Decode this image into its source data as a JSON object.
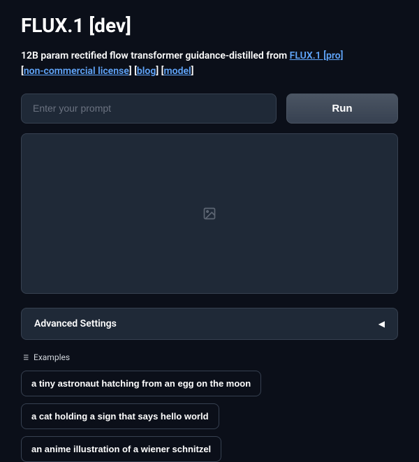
{
  "title": "FLUX.1 [dev]",
  "description": {
    "prefix": "12B param rectified flow transformer guidance-distilled from ",
    "link1": "FLUX.1 [pro]",
    "link2": "non-commercial license",
    "link3": "blog",
    "link4": "model"
  },
  "prompt": {
    "placeholder": "Enter your prompt",
    "value": ""
  },
  "run_button": "Run",
  "advanced_settings": "Advanced Settings",
  "examples_label": "Examples",
  "examples": [
    "a tiny astronaut hatching from an egg on the moon",
    "a cat holding a sign that says hello world",
    "an anime illustration of a wiener schnitzel"
  ]
}
